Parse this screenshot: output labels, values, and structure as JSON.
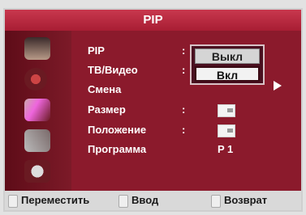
{
  "title": "PIP",
  "menu": [
    {
      "label": "PIP",
      "sep": ":"
    },
    {
      "label": "ТВ/Видео",
      "sep": ":"
    },
    {
      "label": "Смена",
      "sep": ""
    },
    {
      "label": "Размер",
      "sep": ":"
    },
    {
      "label": "Положение",
      "sep": ":"
    },
    {
      "label": "Программа",
      "sep": ""
    }
  ],
  "popup": {
    "options": [
      "Выкл",
      "Вкл"
    ],
    "selected": "Вкл"
  },
  "program_value": "P  1",
  "footer": {
    "move": "Переместить",
    "enter": "Ввод",
    "back": "Возврат"
  },
  "colors": {
    "background": "#8b1a2c",
    "title_bar": "#c8384e",
    "footer": "#d9d9d9"
  },
  "icons": [
    "input-icon",
    "picture-icon",
    "sound-icon",
    "channel-icon",
    "setup-icon"
  ]
}
